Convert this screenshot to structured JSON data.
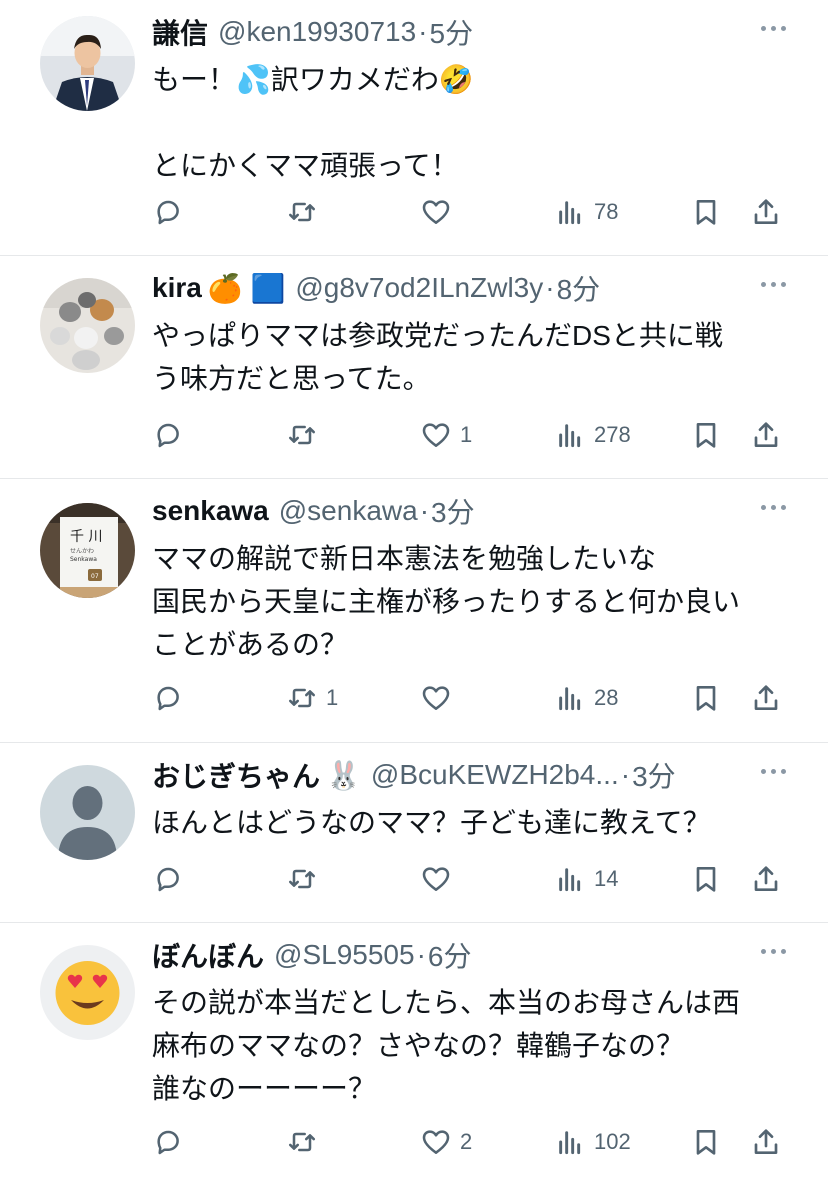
{
  "tweets": [
    {
      "name": "謙信",
      "name_badge": "",
      "handle": "@ken19930713",
      "time": "5分",
      "lines": [
        "もー！💦訳ワカメだわ🤣",
        "",
        "とにかくママ頑張って！"
      ],
      "replies": "",
      "retweets": "",
      "likes": "",
      "views": "78",
      "avatar_icon": "man-in-suit-photo"
    },
    {
      "name": "kira",
      "name_badge": "🍊 🟦",
      "handle": "@g8v7od2ILnZwl3y",
      "time": "8分",
      "lines": [
        "やっぱりママは参政党だったんだDSと共に戦",
        "う味方だと思ってた。"
      ],
      "replies": "",
      "retweets": "",
      "likes": "1",
      "views": "278",
      "avatar_icon": "cats-photo"
    },
    {
      "name": "senkawa",
      "name_badge": "",
      "handle": "@senkawa",
      "time": "3分",
      "lines": [
        "ママの解説で新日本憲法を勉強したいな",
        "国民から天皇に主権が移ったりすると何か良い",
        "ことがあるの？"
      ],
      "replies": "",
      "retweets": "1",
      "likes": "",
      "views": "28",
      "avatar_icon": "station-sign-photo"
    },
    {
      "name": "おじぎちゃん",
      "name_badge": "🐰",
      "handle": "@BcuKEWZH2b4...",
      "time": "3分",
      "lines": [
        "ほんとはどうなのママ？子ども達に教えて？"
      ],
      "replies": "",
      "retweets": "",
      "likes": "",
      "views": "14",
      "avatar_icon": "default-avatar-icon"
    },
    {
      "name": "ぼんぼん",
      "name_badge": "",
      "handle": "@SL95505",
      "time": "6分",
      "lines": [
        "その説が本当だとしたら、本当のお母さんは西",
        "麻布のママなの？さやなの？韓鶴子なの？",
        "誰なのーーーー？"
      ],
      "replies": "",
      "retweets": "",
      "likes": "2",
      "views": "102",
      "avatar_icon": "heart-eyes-emoji"
    }
  ],
  "separator": "·",
  "colors": {
    "text": "#0f1419",
    "secondary": "#536471",
    "divider": "#e6e8ea"
  }
}
